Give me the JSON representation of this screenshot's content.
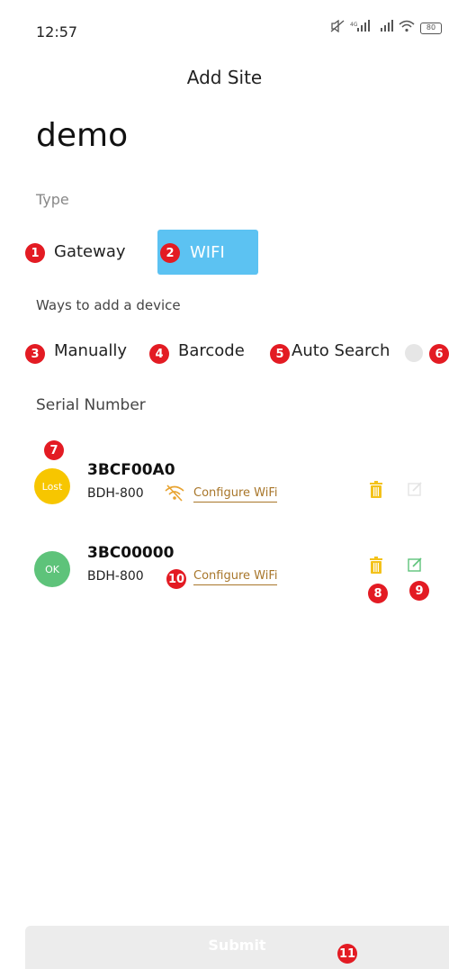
{
  "status_bar": {
    "time": "12:57",
    "signal1": "4G",
    "battery": "80"
  },
  "header": {
    "title": "Add Site"
  },
  "site": {
    "name": "demo"
  },
  "type_section": {
    "label": "Type",
    "options": [
      {
        "label": "Gateway",
        "badge": "1"
      },
      {
        "label": "WIFI",
        "badge": "2"
      }
    ],
    "selected": "WIFI"
  },
  "ways_section": {
    "label": "Ways to add a device",
    "options": [
      {
        "label": "Manually",
        "badge": "3"
      },
      {
        "label": "Barcode",
        "badge": "4"
      },
      {
        "label": "Auto Search",
        "badge": "5"
      }
    ],
    "info_badge": "6"
  },
  "serial_section": {
    "label": "Serial Number"
  },
  "devices": [
    {
      "avatar_text": "Lost",
      "avatar_color": "#f7c600",
      "serial": "3BCF00A0",
      "model": "BDH-800",
      "configure": "Configure WiFi",
      "badge": "7"
    },
    {
      "avatar_text": "OK",
      "avatar_color": "#5ec37a",
      "serial": "3BC00000",
      "model": "BDH-800",
      "configure": "Configure WiFi",
      "badge_config": "10",
      "badge_trash": "8",
      "badge_edit": "9"
    }
  ],
  "colors": {
    "accent": "#5cc2f2",
    "badge": "#e31b23",
    "link": "#a8762a",
    "trash": "#f3c21b",
    "edit": "#5ec37a"
  },
  "submit": {
    "label": "Submit",
    "badge": "11"
  }
}
